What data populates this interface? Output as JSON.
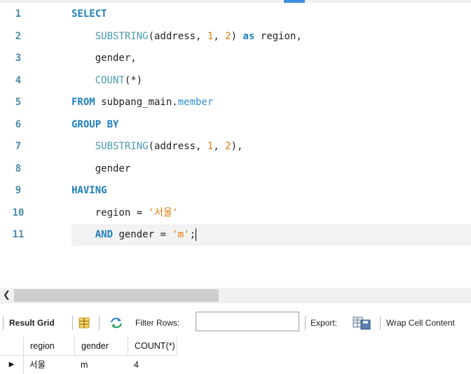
{
  "editor": {
    "lines": [
      {
        "n": "1"
      },
      {
        "n": "2"
      },
      {
        "n": "3"
      },
      {
        "n": "4"
      },
      {
        "n": "5"
      },
      {
        "n": "6"
      },
      {
        "n": "7"
      },
      {
        "n": "8"
      },
      {
        "n": "9"
      },
      {
        "n": "10"
      },
      {
        "n": "11"
      }
    ],
    "tokens": {
      "select": "SELECT",
      "substring": "SUBSTRING",
      "address_arg": "(address, ",
      "one": "1",
      "comma_sp": ", ",
      "two": "2",
      "close_paren": ")",
      "as": "as",
      "region_alias": " region,",
      "gender_comma": "gender,",
      "count": "COUNT",
      "count_arg": "(*)",
      "from": "FROM",
      "schema": " subpang_main.",
      "table": "member",
      "group_by": "GROUP BY",
      "close_paren_comma": "),",
      "gender": "gender",
      "having": "HAVING",
      "region_eq": "region = ",
      "region_value": "'서울'",
      "and": "AND",
      "gender_eq": " gender = ",
      "gender_value": "'m'",
      "semicolon": ";"
    }
  },
  "toolbar": {
    "result_grid": "Result Grid",
    "filter_rows": "Filter Rows:",
    "filter_value": "",
    "export": "Export:",
    "wrap": "Wrap Cell Content"
  },
  "grid": {
    "columns": [
      "region",
      "gender",
      "COUNT(*)"
    ],
    "rows": [
      {
        "region": "서울",
        "gender": "m",
        "count": "4"
      }
    ]
  },
  "colors": {
    "keyword": "#1f7fbf",
    "function": "#4a9ab0",
    "number": "#e07a10",
    "line_number": "#4a8ca8",
    "current_line": "#f2f2f2"
  },
  "icons": {
    "grid_toggle": "grid-icon",
    "refresh": "refresh-icon",
    "export": "export-icon",
    "row_indicator": "current-row-arrow-icon",
    "scroll_left": "scroll-left-arrow-icon"
  }
}
